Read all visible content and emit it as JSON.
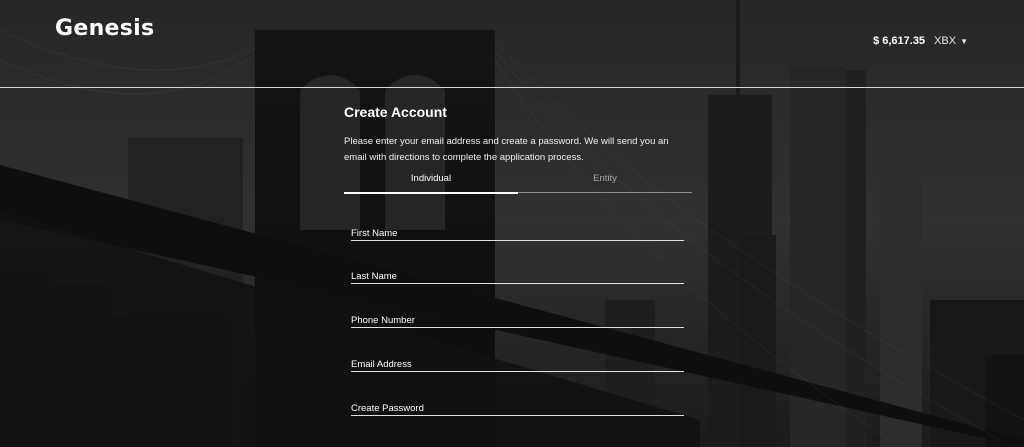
{
  "header": {
    "logo": "Genesis",
    "price": "$ 6,617.35",
    "currency": "XBX",
    "currency_caret": "▼"
  },
  "form": {
    "title": "Create Account",
    "description": "Please enter your email address and create a password. We will send you an email with directions to complete the application process.",
    "tabs": [
      {
        "label": "Individual",
        "active": true
      },
      {
        "label": "Entity",
        "active": false
      }
    ],
    "fields": [
      {
        "label": "First Name",
        "value": ""
      },
      {
        "label": "Last Name",
        "value": ""
      },
      {
        "label": "Phone Number",
        "value": ""
      },
      {
        "label": "Email Address",
        "value": ""
      },
      {
        "label": "Create Password",
        "value": ""
      }
    ]
  },
  "colors": {
    "text": "#ffffff",
    "inactive_tab": "#a8a8a8",
    "divider": "#d8d8d8"
  }
}
